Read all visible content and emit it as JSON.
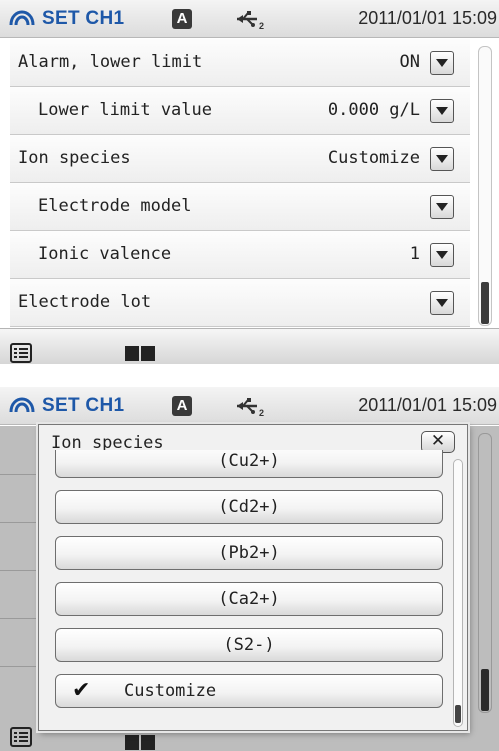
{
  "screens": [
    {
      "header": {
        "title": "SET CH1",
        "mode_badge": "A",
        "datetime": "2011/01/01 15:09"
      },
      "rows": [
        {
          "label": "Alarm, lower limit",
          "value": "ON"
        },
        {
          "label": "Lower limit value",
          "value": "0.000 g/L"
        },
        {
          "label": "Ion species",
          "value": "Customize"
        },
        {
          "label": "Electrode model",
          "value": ""
        },
        {
          "label": "Ionic valence",
          "value": "1"
        },
        {
          "label": "Electrode lot",
          "value": ""
        }
      ]
    },
    {
      "header": {
        "title": "SET CH1",
        "mode_badge": "A",
        "datetime": "2011/01/01 15:09"
      },
      "popup": {
        "title": "Ion species",
        "close_label": "✕",
        "options": [
          {
            "label": "(Cu2+)",
            "selected": false
          },
          {
            "label": "(Cd2+)",
            "selected": false
          },
          {
            "label": "(Pb2+)",
            "selected": false
          },
          {
            "label": "(Ca2+)",
            "selected": false
          },
          {
            "label": "(S2-)",
            "selected": false
          },
          {
            "label": "Customize",
            "selected": true
          }
        ],
        "check_mark": "✔"
      }
    }
  ],
  "icons": {
    "logo": "ch-logo-icon",
    "usb": "usb-icon",
    "list": "list-icon",
    "book": "book-icon",
    "dropdown": "chevron-down-icon"
  },
  "colors": {
    "title_blue": "#1e58a8",
    "dim_overlay": "#bdbdbd"
  }
}
